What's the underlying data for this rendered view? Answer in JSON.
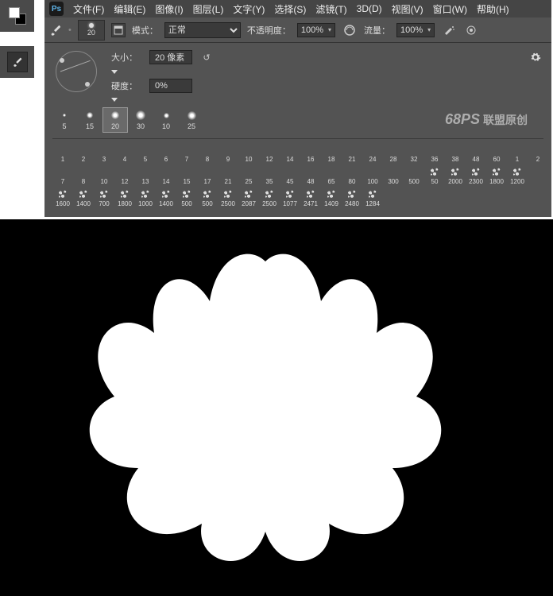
{
  "menu": {
    "items": [
      "文件(F)",
      "编辑(E)",
      "图像(I)",
      "图层(L)",
      "文字(Y)",
      "选择(S)",
      "滤镜(T)",
      "3D(D)",
      "视图(V)",
      "窗口(W)",
      "帮助(H)"
    ],
    "logo": "Ps"
  },
  "options": {
    "brush_size": "20",
    "mode_label": "模式：",
    "mode_value": "正常",
    "opacity_label": "不透明度：",
    "opacity_value": "100%",
    "flow_label": "流量：",
    "flow_value": "100%"
  },
  "brush_popup": {
    "size_label": "大小：",
    "size_value": "20 像素",
    "hardness_label": "硬度：",
    "hardness_value": "0%",
    "recent": [
      {
        "size": "5",
        "tip": "soft",
        "d": 4
      },
      {
        "size": "15",
        "tip": "soft",
        "d": 8
      },
      {
        "size": "20",
        "tip": "soft",
        "d": 10,
        "selected": true
      },
      {
        "size": "30",
        "tip": "soft",
        "d": 12
      },
      {
        "size": "10",
        "tip": "soft",
        "d": 7
      },
      {
        "size": "25",
        "tip": "soft",
        "d": 11
      }
    ],
    "grid": [
      {
        "n": "1",
        "t": "soft",
        "d": 3
      },
      {
        "n": "2",
        "t": "soft",
        "d": 4
      },
      {
        "n": "3",
        "t": "soft",
        "d": 4
      },
      {
        "n": "4",
        "t": "soft",
        "d": 5
      },
      {
        "n": "5",
        "t": "soft",
        "d": 5
      },
      {
        "n": "6",
        "t": "soft",
        "d": 6
      },
      {
        "n": "7",
        "t": "soft",
        "d": 6
      },
      {
        "n": "8",
        "t": "soft",
        "d": 7
      },
      {
        "n": "9",
        "t": "soft",
        "d": 7
      },
      {
        "n": "10",
        "t": "soft",
        "d": 8
      },
      {
        "n": "12",
        "t": "soft",
        "d": 8
      },
      {
        "n": "14",
        "t": "soft",
        "d": 9
      },
      {
        "n": "16",
        "t": "soft",
        "d": 9
      },
      {
        "n": "18",
        "t": "soft",
        "d": 10
      },
      {
        "n": "21",
        "t": "soft",
        "d": 10
      },
      {
        "n": "24",
        "t": "soft",
        "d": 11
      },
      {
        "n": "28",
        "t": "soft",
        "d": 11
      },
      {
        "n": "32",
        "t": "soft",
        "d": 12
      },
      {
        "n": "36",
        "t": "soft",
        "d": 12
      },
      {
        "n": "38",
        "t": "soft",
        "d": 12
      },
      {
        "n": "48",
        "t": "soft",
        "d": 13
      },
      {
        "n": "60",
        "t": "soft",
        "d": 13
      },
      {
        "n": "1",
        "t": "hard",
        "d": 3
      },
      {
        "n": "2",
        "t": "hard",
        "d": 4
      },
      {
        "n": "7",
        "t": "hard",
        "d": 5
      },
      {
        "n": "8",
        "t": "hard",
        "d": 5
      },
      {
        "n": "10",
        "t": "hard",
        "d": 6
      },
      {
        "n": "12",
        "t": "hard",
        "d": 6
      },
      {
        "n": "13",
        "t": "hard",
        "d": 7
      },
      {
        "n": "14",
        "t": "hard",
        "d": 7
      },
      {
        "n": "15",
        "t": "hard",
        "d": 7
      },
      {
        "n": "17",
        "t": "hard",
        "d": 8
      },
      {
        "n": "21",
        "t": "hard",
        "d": 8
      },
      {
        "n": "25",
        "t": "hard",
        "d": 9
      },
      {
        "n": "35",
        "t": "hard",
        "d": 10
      },
      {
        "n": "45",
        "t": "hard",
        "d": 10
      },
      {
        "n": "48",
        "t": "hard",
        "d": 11
      },
      {
        "n": "65",
        "t": "hard",
        "d": 11
      },
      {
        "n": "80",
        "t": "hard",
        "d": 12
      },
      {
        "n": "100",
        "t": "hard",
        "d": 12
      },
      {
        "n": "300",
        "t": "hard",
        "d": 13
      },
      {
        "n": "500",
        "t": "hard",
        "d": 13
      },
      {
        "n": "50",
        "t": "splat"
      },
      {
        "n": "2000",
        "t": "splat"
      },
      {
        "n": "2300",
        "t": "splat"
      },
      {
        "n": "1800",
        "t": "splat"
      },
      {
        "n": "1200",
        "t": "splat"
      },
      {
        "n": "",
        "t": "blank"
      },
      {
        "n": "1600",
        "t": "splat"
      },
      {
        "n": "1400",
        "t": "splat"
      },
      {
        "n": "700",
        "t": "splat"
      },
      {
        "n": "1800",
        "t": "splat"
      },
      {
        "n": "1000",
        "t": "splat"
      },
      {
        "n": "1400",
        "t": "splat"
      },
      {
        "n": "500",
        "t": "splat"
      },
      {
        "n": "500",
        "t": "splat"
      },
      {
        "n": "2500",
        "t": "splat"
      },
      {
        "n": "2087",
        "t": "splat"
      },
      {
        "n": "2500",
        "t": "splat"
      },
      {
        "n": "1077",
        "t": "splat"
      },
      {
        "n": "2471",
        "t": "splat"
      },
      {
        "n": "1409",
        "t": "splat"
      },
      {
        "n": "2480",
        "t": "splat"
      },
      {
        "n": "1284",
        "t": "splat"
      }
    ]
  },
  "watermark": {
    "brand": "68PS",
    "text": "联盟原创"
  },
  "icons": {
    "brush": "brush-icon",
    "gear": "gear-icon",
    "tablet": "tablet-pressure-icon",
    "airbrush": "airbrush-icon",
    "pressure_opacity": "pressure-opacity-icon"
  }
}
